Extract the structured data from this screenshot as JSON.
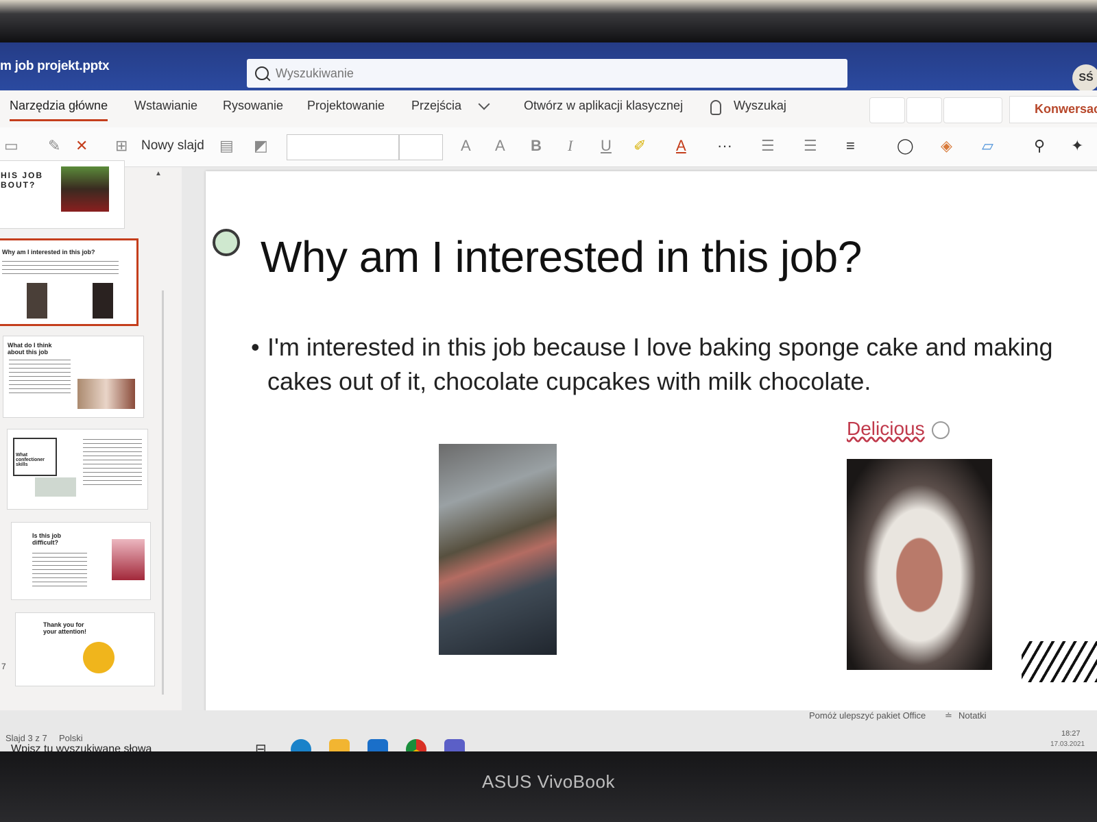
{
  "window": {
    "doc_title": "m job projekt.pptx",
    "search_placeholder": "Wyszukiwanie",
    "avatar": "SŚ"
  },
  "ribbon_tabs": [
    "Narzędzia główne",
    "Wstawianie",
    "Rysowanie",
    "Projektowanie",
    "Przejścia"
  ],
  "ribbon_actions": {
    "open_desktop": "Otwórz w aplikacji klasycznej",
    "tell_me": "Wyszukaj",
    "conversation": "Konwersacj"
  },
  "toolbar": {
    "new_slide": "Nowy slajd",
    "bold": "B",
    "italic": "I",
    "underline": "U",
    "more": "···"
  },
  "thumbnails": [
    {
      "title": "HIS JOB BOUT?"
    },
    {
      "title": "Why am I interested in this job?"
    },
    {
      "title": "What do I think about this job"
    },
    {
      "title": "What confectioner skills"
    },
    {
      "title": "Is this job difficult?"
    },
    {
      "title": "Thank you for your attention!",
      "number": "7"
    }
  ],
  "slide": {
    "title": "Why am I interested in this job?",
    "bullet": "I'm interested in this job because I love baking sponge cake and making cakes out of it, chocolate cupcakes with milk chocolate.",
    "caption": "Delicious"
  },
  "status": {
    "slide_info": "Slajd 3 z 7",
    "language": "Polski",
    "help": "Pomóż ulepszyć pakiet Office",
    "notes": "Notatki"
  },
  "taskbar": {
    "search": "Wpisz tu wyszukiwane słowa",
    "time": "18:27",
    "date": "17.03.2021"
  },
  "device": {
    "brand": "ASUS VivoBook"
  },
  "colors": {
    "title_bar": "#2b4aa0",
    "accent": "#c43e1c"
  }
}
